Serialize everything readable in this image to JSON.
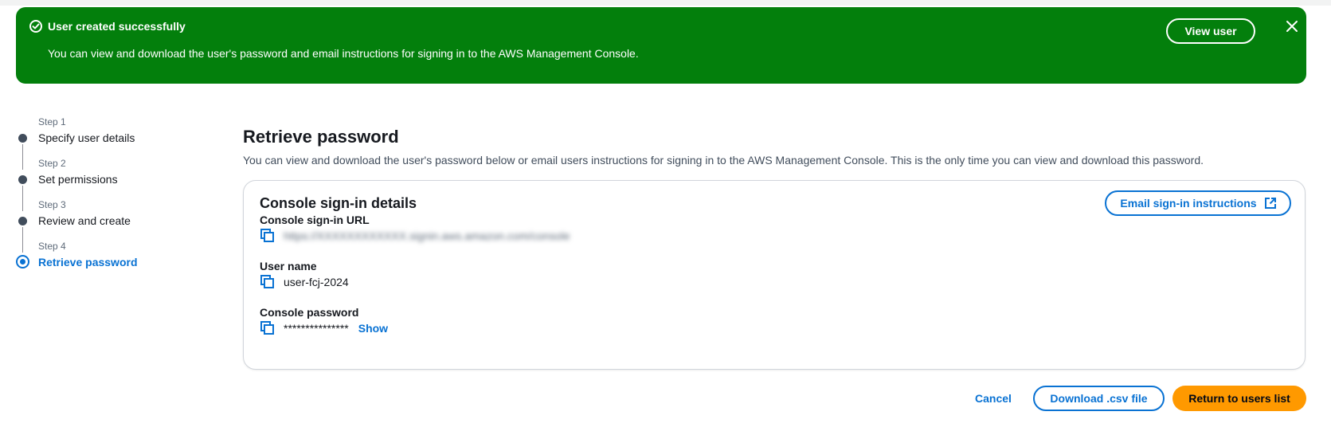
{
  "flash": {
    "title": "User created successfully",
    "message": "You can view and download the user's password and email instructions for signing in to the AWS Management Console.",
    "view_button": "View user",
    "background_color": "#037f0c"
  },
  "steps": [
    {
      "label": "Step 1",
      "title": "Specify user details",
      "active": false
    },
    {
      "label": "Step 2",
      "title": "Set permissions",
      "active": false
    },
    {
      "label": "Step 3",
      "title": "Review and create",
      "active": false
    },
    {
      "label": "Step 4",
      "title": "Retrieve password",
      "active": true
    }
  ],
  "page": {
    "title": "Retrieve password",
    "description": "You can view and download the user's password below or email users instructions for signing in to the AWS Management Console. This is the only time you can view and download this password."
  },
  "card": {
    "title": "Console sign-in details",
    "email_button": "Email sign-in instructions",
    "signin_url_label": "Console sign-in URL",
    "signin_url_value": "https://XXXXXXXXXXXX.signin.aws.amazon.com/console",
    "username_label": "User name",
    "username_value": "user-fcj-2024",
    "password_label": "Console password",
    "password_value": "***************",
    "show_link": "Show"
  },
  "actions": {
    "cancel": "Cancel",
    "download_csv": "Download .csv file",
    "return": "Return to users list"
  },
  "colors": {
    "accent": "#0972d3",
    "primary_button": "#ff9900"
  }
}
